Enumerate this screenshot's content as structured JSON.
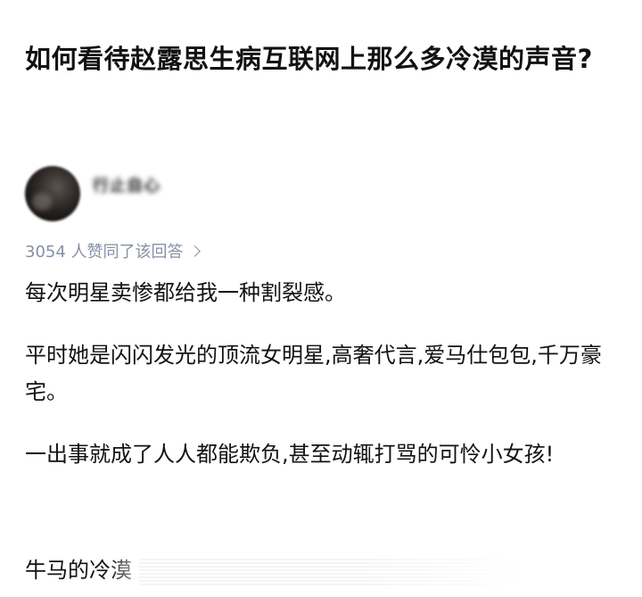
{
  "question": {
    "title": "如何看待赵露思生病互联网上那么多冷漠的声音?"
  },
  "author": {
    "name": "行止自心",
    "avatar_icon": "user-avatar-icon"
  },
  "answer": {
    "vote_text": "3054 人赞同了该回答",
    "paragraphs": [
      "每次明星卖惨都给我一种割裂感。",
      "平时她是闪闪发光的顶流女明星,高奢代言,爱马仕包包,千万豪宅。",
      "一出事就成了人人都能欺负,甚至动辄打骂的可怜小女孩!"
    ],
    "truncated_line": "牛马的冷漠"
  },
  "colors": {
    "text": "#121212",
    "meta": "#8590a6",
    "background": "#ffffff"
  }
}
